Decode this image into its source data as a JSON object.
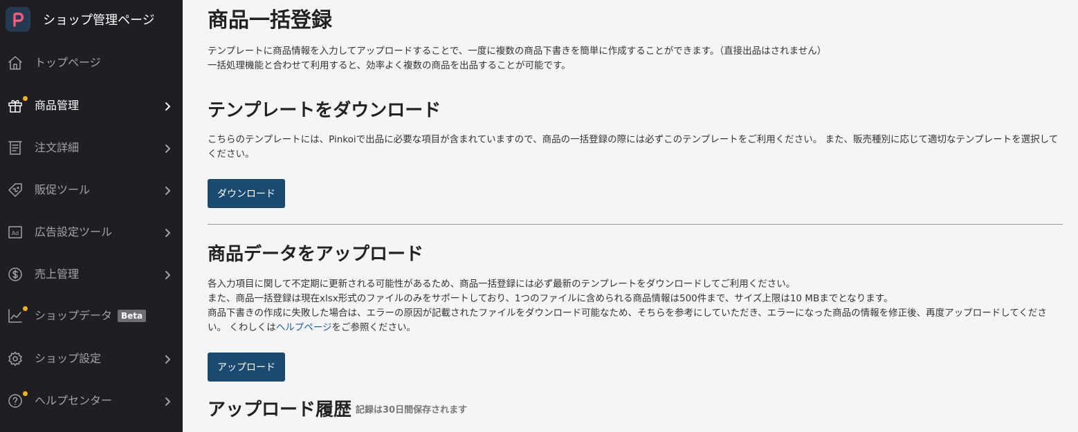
{
  "sidebar": {
    "brand_title": "ショップ管理ページ",
    "items": [
      {
        "label": "トップページ"
      },
      {
        "label": "商品管理"
      },
      {
        "label": "注文詳細"
      },
      {
        "label": "販促ツール"
      },
      {
        "label": "広告設定ツール"
      },
      {
        "label": "売上管理"
      },
      {
        "label": "ショップデータ",
        "badge": "Beta"
      },
      {
        "label": "ショップ設定"
      },
      {
        "label": "ヘルプセンター"
      }
    ],
    "colors": {
      "bg": "#1f1f23",
      "dot": "#f5b21b",
      "logo_bg": "#233a52"
    }
  },
  "main": {
    "title": "商品一括登録",
    "intro_line1": "テンプレートに商品情報を入力してアップロードすることで、一度に複数の商品下書きを簡単に作成することができます。（直接出品はされません）",
    "intro_line2": "一括処理機能と合わせて利用すると、効率よく複数の商品を出品することが可能です。",
    "download": {
      "heading": "テンプレートをダウンロード",
      "text": "こちらのテンプレートには、Pinkoiで出品に必要な項目が含まれていますので、商品の一括登録の際には必ずこのテンプレートをご利用ください。 また、販売種別に応じて適切なテンプレートを選択してください。",
      "button": "ダウンロード"
    },
    "upload": {
      "heading": "商品データをアップロード",
      "line1": "各入力項目に関して不定期に更新される可能性があるため、商品一括登録には必ず最新のテンプレートをダウンロードしてご利用ください。",
      "line2": "また、商品一括登録は現在xlsx形式のファイルのみをサポートしており、1つのファイルに含められる商品情報は500件まで、サイズ上限は10 MBまでとなります。",
      "line3_before": "商品下書きの作成に失敗した場合は、エラーの原因が記載されたファイルをダウンロード可能なため、そちらを参考にしていただき、エラーになった商品の情報を修正後、再度アップロードしてください。 くわしくは",
      "line3_link": "ヘルプページ",
      "line3_after": "をご参照ください。",
      "button": "アップロード"
    },
    "history": {
      "heading": "アップロード履歴",
      "note": "記録は30日間保存されます"
    },
    "colors": {
      "button": "#1a4a70",
      "link": "#1a5fa0",
      "background": "#f5f5f5"
    }
  }
}
